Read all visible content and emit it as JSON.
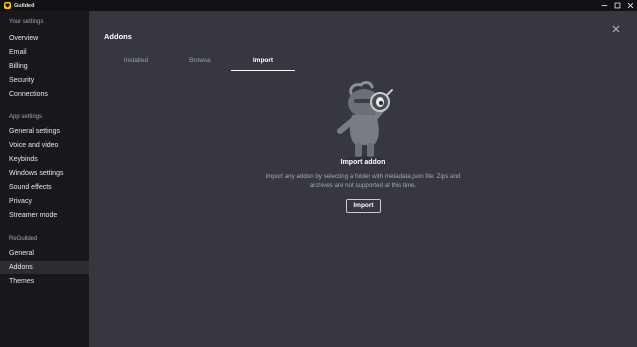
{
  "window": {
    "title": "Guilded",
    "logo_color": "#f5c400"
  },
  "sidebar": {
    "sections": [
      {
        "label": "Your settings",
        "items": [
          "Overview",
          "Email",
          "Billing",
          "Security",
          "Connections"
        ]
      },
      {
        "label": "App settings",
        "items": [
          "General settings",
          "Voice and video",
          "Keybinds",
          "Windows settings",
          "Sound effects",
          "Privacy",
          "Streamer mode"
        ]
      },
      {
        "label": "ReGuilded",
        "items": [
          "General",
          "Addons",
          "Themes"
        ]
      }
    ],
    "active_item": "Addons"
  },
  "main": {
    "title": "Addons",
    "tabs": [
      {
        "label": "Installed"
      },
      {
        "label": "Browse"
      },
      {
        "label": "Import"
      }
    ],
    "active_tab": "Import",
    "empty_state": {
      "title": "Import addon",
      "description": "Import any addon by selecting a folder with metadata.json file. Zips and archives are not supported at this time.",
      "button_label": "Import",
      "illustration": "knight-with-magnifying-glass"
    }
  },
  "colors": {
    "sidebar_bg": "#17181b",
    "main_bg": "#36373f",
    "active_item_bg": "#2b2d33"
  }
}
